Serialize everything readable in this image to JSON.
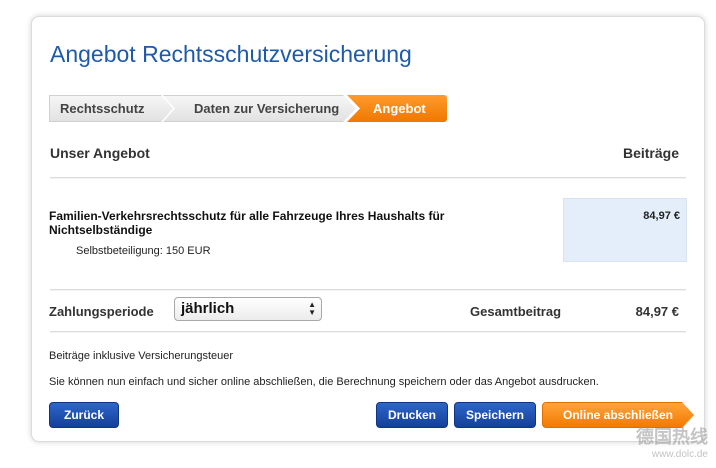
{
  "title": "Angebot Rechtsschutzversicherung",
  "steps": [
    {
      "label": "Rechtsschutz",
      "state": "done"
    },
    {
      "label": "Daten zur Versicherung",
      "state": "done"
    },
    {
      "label": "Angebot",
      "state": "active"
    }
  ],
  "offer_header": {
    "left": "Unser Angebot",
    "right": "Beiträge"
  },
  "product": {
    "name": "Familien-Verkehrsrechtsschutz für alle Fahrzeuge Ihres Haushalts für Nichtselbständige",
    "deductible": "Selbstbeteiligung: 150 EUR",
    "price": "84,97 €"
  },
  "payment": {
    "label": "Zahlungsperiode",
    "selected": "jährlich"
  },
  "total": {
    "label": "Gesamtbeitrag",
    "value": "84,97 €"
  },
  "notes": {
    "tax": "Beiträge inklusive Versicherungsteuer",
    "info": "Sie können nun einfach und sicher online abschließen, die Berechnung speichern oder das Angebot ausdrucken."
  },
  "buttons": {
    "back": "Zurück",
    "print": "Drucken",
    "save": "Speichern",
    "online": "Online abschließen"
  },
  "colors": {
    "title": "#1f5aa8",
    "accent_orange": "#f37a00",
    "button_blue": "#1a4aa8",
    "price_bg": "#e4eefb"
  },
  "watermark": {
    "line1": "德国热线",
    "line2": "www.dolc.de"
  }
}
